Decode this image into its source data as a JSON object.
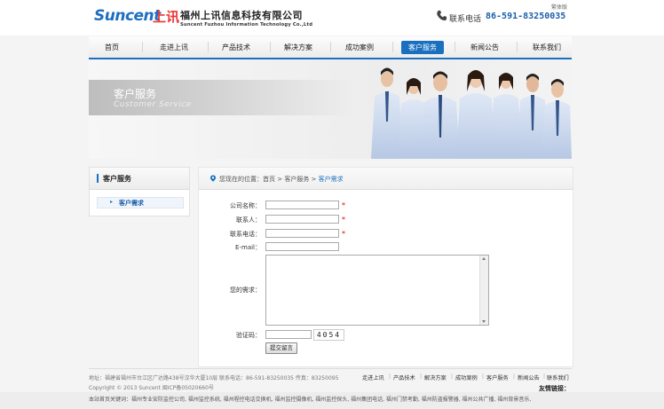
{
  "header": {
    "logo_en": "Suncent",
    "logo_cn": "上讯",
    "company_cn": "福州上讯信息科技有限公司",
    "company_en": "Suncent Fuzhou Information Technology Co.,Ltd",
    "lang_switch": "繁体版",
    "phone_label": "联系电话",
    "phone_number": "86-591-83250035"
  },
  "nav": {
    "items": [
      "首页",
      "走进上讯",
      "产品技术",
      "解决方案",
      "成功案例",
      "客户服务",
      "新闻公告",
      "联系我们"
    ],
    "active_index": 5
  },
  "banner": {
    "title_cn": "客户服务",
    "title_en": "Customer Service"
  },
  "sidebar": {
    "title": "客户服务",
    "items": [
      "客户需求"
    ]
  },
  "breadcrumb": {
    "prefix": "您现在的位置：",
    "home": "首页",
    "sep1": " > ",
    "section": "客户服务",
    "sep2": " > ",
    "current": "客户需求"
  },
  "form": {
    "company_label": "公司名称：",
    "contact_label": "联系人：",
    "phone_label": "联系电话：",
    "email_label": "E-mail：",
    "needs_label": "您的需求：",
    "captcha_label": "验证码：",
    "captcha_value": "4054",
    "required_mark": "*",
    "submit_label": "提交留言"
  },
  "footer": {
    "address": "地址：福建省福州市台江区广达路438号汉华大厦10层 联系电话：86-591-83250035   传真：83250095",
    "copyright": "Copyright © 2013 Suncent 闽ICP备05020660号",
    "links": [
      "走进上讯",
      "产品技术",
      "解决方案",
      "成功案例",
      "客户服务",
      "新闻公告",
      "联系我们"
    ],
    "link_sep": "|",
    "friend_links_label": "友情链接：",
    "keywords": "本站首页关键词：福州专业安防监控公司, 福州监控系统, 福州程控电话交换机, 福州监控摄像机, 福州监控探头, 福州集团电话, 福州门禁考勤, 福州防盗报警器, 福州公共广播, 福州背景音乐,"
  },
  "colors": {
    "brand_blue": "#1a6fbf",
    "required_red": "#dd0000"
  }
}
